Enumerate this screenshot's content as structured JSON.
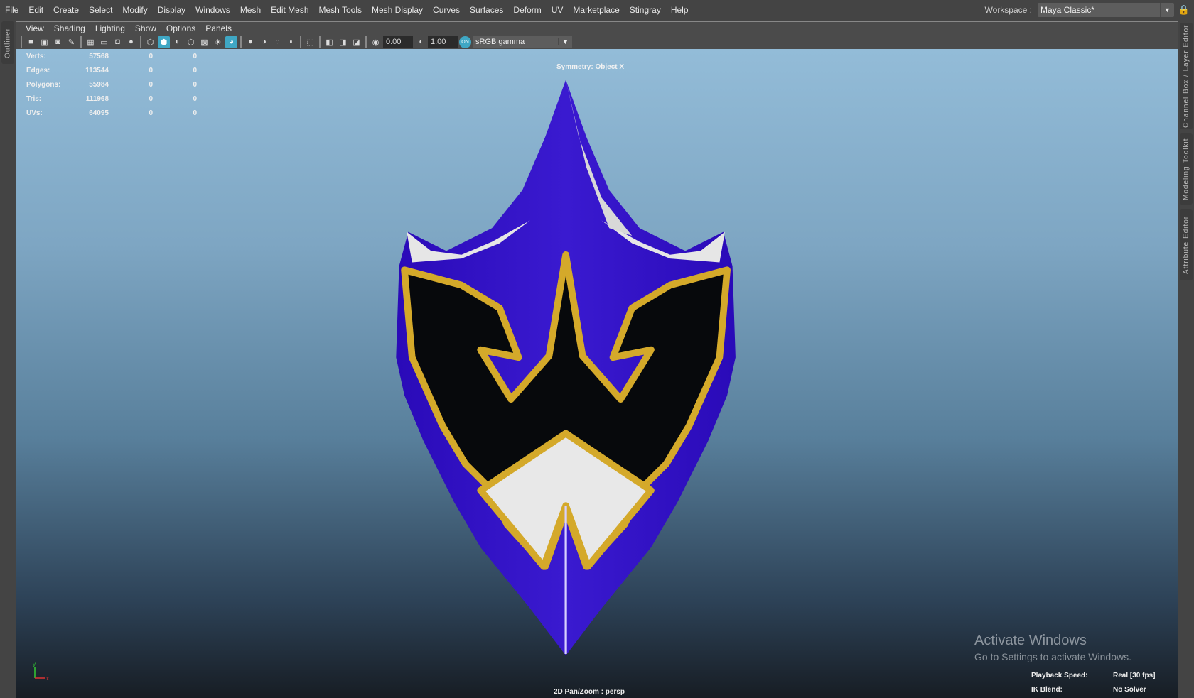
{
  "menubar": {
    "items": [
      "File",
      "Edit",
      "Create",
      "Select",
      "Modify",
      "Display",
      "Windows",
      "Mesh",
      "Edit Mesh",
      "Mesh Tools",
      "Mesh Display",
      "Curves",
      "Surfaces",
      "Deform",
      "UV",
      "Marketplace",
      "Stingray",
      "Help"
    ]
  },
  "workspace": {
    "label": "Workspace :",
    "value": "Maya Classic*"
  },
  "side_tabs": {
    "left": "Outliner",
    "right": [
      "Channel Box / Layer Editor",
      "Modeling Toolkit",
      "Attribute Editor"
    ]
  },
  "panel_menu": [
    "View",
    "Shading",
    "Lighting",
    "Show",
    "Options",
    "Panels"
  ],
  "toolbar": {
    "exposure": "0.00",
    "gamma": "1.00",
    "color_mgmt": "ON",
    "view_transform": "sRGB gamma"
  },
  "stats": [
    {
      "label": "Verts:",
      "value": "57568",
      "sel": "0",
      "sel2": "0"
    },
    {
      "label": "Edges:",
      "value": "113544",
      "sel": "0",
      "sel2": "0"
    },
    {
      "label": "Polygons:",
      "value": "55984",
      "sel": "0",
      "sel2": "0"
    },
    {
      "label": "Tris:",
      "value": "111968",
      "sel": "0",
      "sel2": "0"
    },
    {
      "label": "UVs:",
      "value": "64095",
      "sel": "0",
      "sel2": "0"
    }
  ],
  "viewport": {
    "symmetry": "Symmetry: Object X",
    "camera": "2D Pan/Zoom : persp",
    "axis_y": "y",
    "axis_x": "x"
  },
  "hud": {
    "playback_label": "Playback Speed:",
    "playback_value": "Real [30 fps]",
    "ik_label": "IK Blend:",
    "ik_value": "No Solver"
  },
  "watermark": {
    "title": "Activate Windows",
    "subtitle": "Go to Settings to activate Windows."
  },
  "colors": {
    "mask_blue": "#2a0ab8",
    "gold": "#d4a92a",
    "visor": "#07090c",
    "white": "#e8e8e8",
    "accent": "#3fa7c4"
  }
}
